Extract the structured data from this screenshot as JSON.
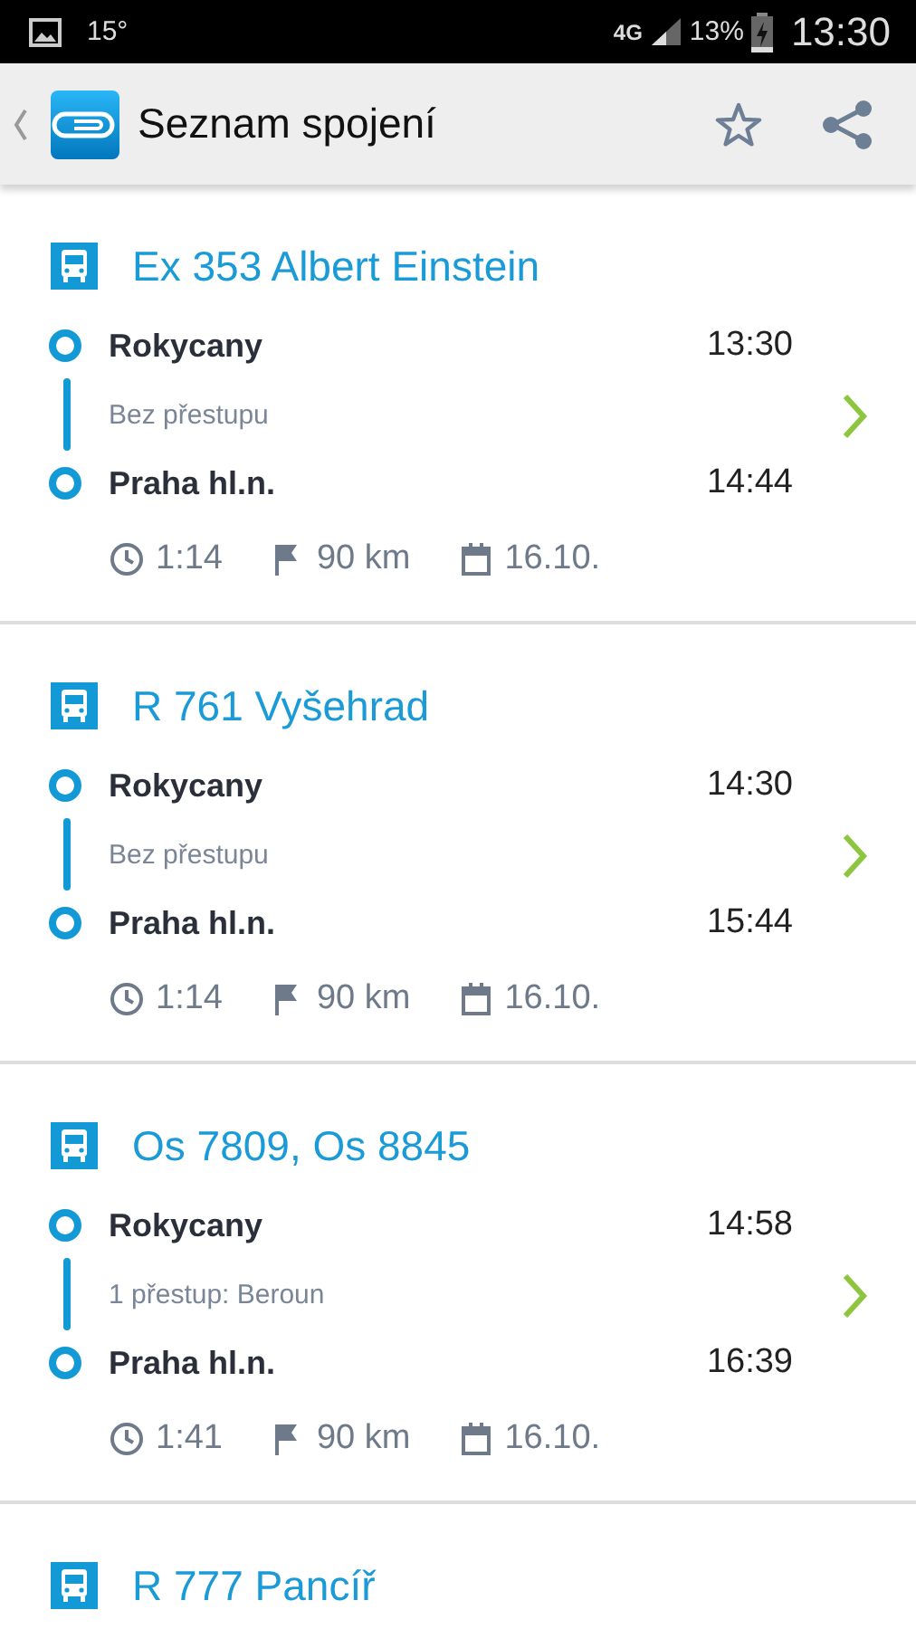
{
  "status_bar": {
    "temperature": "15°",
    "network": "4G",
    "battery": "13%",
    "time": "13:30"
  },
  "app_bar": {
    "title": "Seznam spojení"
  },
  "connections": [
    {
      "train": "Ex 353 Albert Einstein",
      "from": {
        "station": "Rokycany",
        "time": "13:30"
      },
      "transfer": "Bez přestupu",
      "to": {
        "station": "Praha hl.n.",
        "time": "14:44"
      },
      "duration": "1:14",
      "distance": "90 km",
      "date": "16.10."
    },
    {
      "train": "R 761 Vyšehrad",
      "from": {
        "station": "Rokycany",
        "time": "14:30"
      },
      "transfer": "Bez přestupu",
      "to": {
        "station": "Praha hl.n.",
        "time": "15:44"
      },
      "duration": "1:14",
      "distance": "90 km",
      "date": "16.10."
    },
    {
      "train": "Os 7809, Os 8845",
      "from": {
        "station": "Rokycany",
        "time": "14:58"
      },
      "transfer": "1 přestup: Beroun",
      "to": {
        "station": "Praha hl.n.",
        "time": "16:39"
      },
      "duration": "1:41",
      "distance": "90 km",
      "date": "16.10."
    },
    {
      "train": "R 777 Pancíř"
    }
  ]
}
